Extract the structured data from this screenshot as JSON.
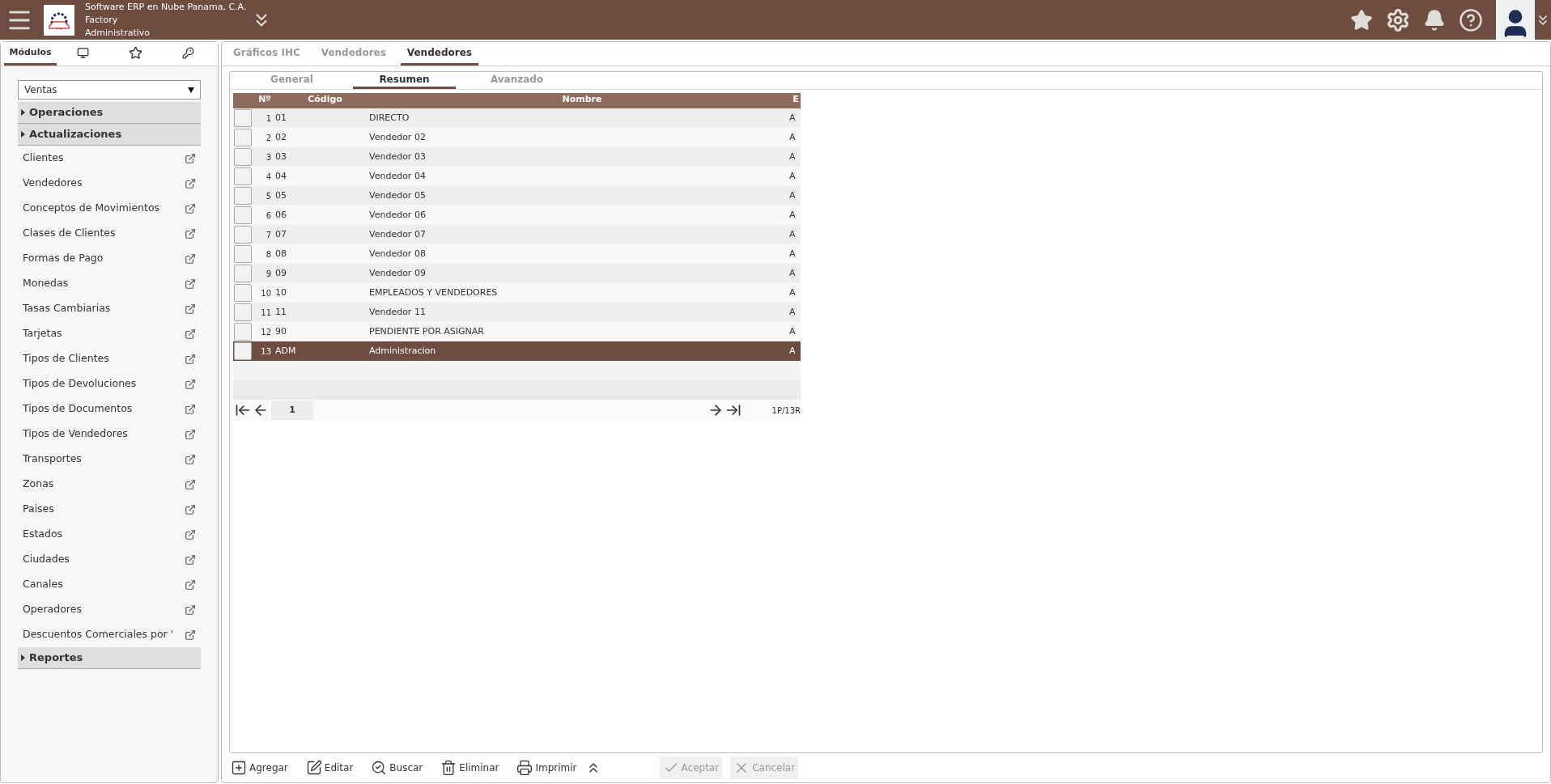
{
  "header": {
    "company": "Software ERP en Nube Panama, C.A.",
    "app": "Factory",
    "role": "Administrativo"
  },
  "sidebar": {
    "tabs": [
      {
        "kind": "text",
        "label": "Módulos",
        "selected": true
      },
      {
        "kind": "monitor",
        "selected": false
      },
      {
        "kind": "star",
        "selected": false
      },
      {
        "kind": "key",
        "selected": false
      }
    ],
    "module": "Ventas",
    "sections": [
      {
        "label": "Operaciones"
      },
      {
        "label": "Actualizaciones",
        "items": [
          "Clientes",
          "Vendedores",
          "Conceptos de Movimientos",
          "Clases de Clientes",
          "Formas de Pago",
          "Monedas",
          "Tasas Cambiarias",
          "Tarjetas",
          "Tipos de Clientes",
          "Tipos de Devoluciones",
          "Tipos de Documentos",
          "Tipos de Vendedores",
          "Transportes",
          "Zonas",
          "Paises",
          "Estados",
          "Ciudades",
          "Canales",
          "Operadores",
          "Descuentos Comerciales por '"
        ]
      },
      {
        "label": "Reportes"
      }
    ]
  },
  "tabs": [
    {
      "label": "Gráficos IHC",
      "selected": false
    },
    {
      "label": "Vendedores",
      "selected": false
    },
    {
      "label": "Vendedores",
      "selected": true
    }
  ],
  "subtabs": [
    {
      "label": "General",
      "selected": false
    },
    {
      "label": "Resumen",
      "selected": true
    },
    {
      "label": "Avanzado",
      "selected": false
    }
  ],
  "table": {
    "columns": [
      "Nº",
      "Código",
      "Nombre",
      "E"
    ],
    "rows": [
      {
        "n": "1",
        "code": "01",
        "name": "DIRECTO",
        "e": "A",
        "selected": false
      },
      {
        "n": "2",
        "code": "02",
        "name": "Vendedor 02",
        "e": "A",
        "selected": false
      },
      {
        "n": "3",
        "code": "03",
        "name": "Vendedor 03",
        "e": "A",
        "selected": false
      },
      {
        "n": "4",
        "code": "04",
        "name": "Vendedor 04",
        "e": "A",
        "selected": false
      },
      {
        "n": "5",
        "code": "05",
        "name": "Vendedor 05",
        "e": "A",
        "selected": false
      },
      {
        "n": "6",
        "code": "06",
        "name": "Vendedor 06",
        "e": "A",
        "selected": false
      },
      {
        "n": "7",
        "code": "07",
        "name": "Vendedor 07",
        "e": "A",
        "selected": false
      },
      {
        "n": "8",
        "code": "08",
        "name": "Vendedor 08",
        "e": "A",
        "selected": false
      },
      {
        "n": "9",
        "code": "09",
        "name": "Vendedor 09",
        "e": "A",
        "selected": false
      },
      {
        "n": "10",
        "code": "10",
        "name": "EMPLEADOS Y VENDEDORES",
        "e": "A",
        "selected": false
      },
      {
        "n": "11",
        "code": "11",
        "name": "Vendedor 11",
        "e": "A",
        "selected": false
      },
      {
        "n": "12",
        "code": "90",
        "name": "PENDIENTE POR ASIGNAR",
        "e": "A",
        "selected": false
      },
      {
        "n": "13",
        "code": "ADM",
        "name": "Administracion",
        "e": "A",
        "selected": true
      }
    ],
    "page": "1",
    "summary": "1P/13R"
  },
  "toolbar": [
    {
      "kind": "add",
      "label": "Agregar",
      "disabled": false
    },
    {
      "kind": "edit",
      "label": "Editar",
      "disabled": false
    },
    {
      "kind": "search",
      "label": "Buscar",
      "disabled": false
    },
    {
      "kind": "delete",
      "label": "Eliminar",
      "disabled": false
    },
    {
      "kind": "print",
      "label": "Imprimir",
      "disabled": false
    },
    {
      "kind": "collapse",
      "disabled": false
    },
    {
      "kind": "accept",
      "label": "Aceptar",
      "disabled": true
    },
    {
      "kind": "cancel",
      "label": "Cancelar",
      "disabled": true
    }
  ]
}
